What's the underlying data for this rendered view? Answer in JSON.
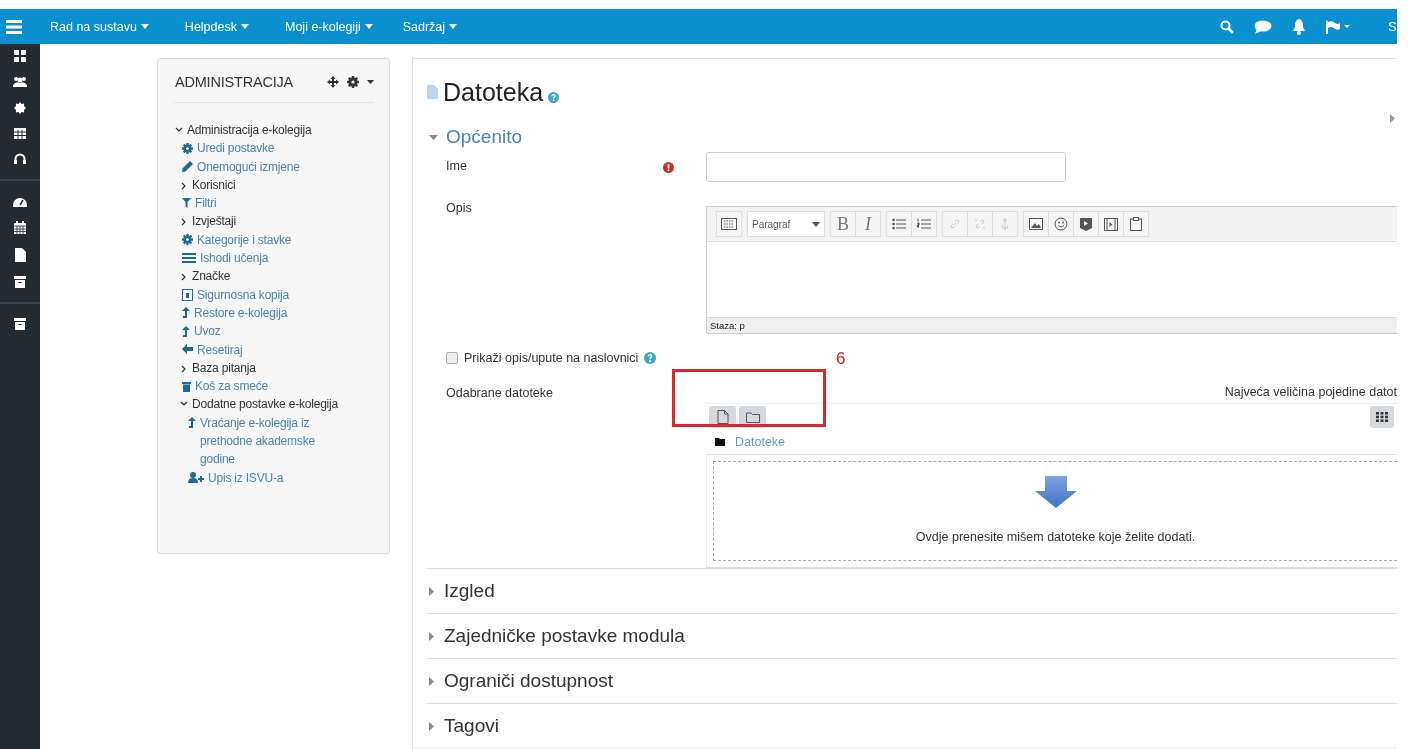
{
  "navbar": {
    "menus": [
      {
        "label": "Rad na sustavu"
      },
      {
        "label": "Helpdesk"
      },
      {
        "label": "Moji e-kolegiji"
      },
      {
        "label": "Sadržaj"
      }
    ],
    "user_initial": "S"
  },
  "block": {
    "title": "ADMINISTRACIJA",
    "tree": [
      {
        "label": "Administracija e-kolegija",
        "kind": "branch",
        "expanded": true,
        "children": [
          {
            "label": "Uredi postavke",
            "kind": "link"
          },
          {
            "label": "Onemogući izmjene",
            "kind": "link"
          },
          {
            "label": "Korisnici",
            "kind": "branch",
            "expanded": false
          },
          {
            "label": "Filtri",
            "kind": "link"
          },
          {
            "label": "Izvještaji",
            "kind": "branch",
            "expanded": false
          },
          {
            "label": "Kategorije i stavke",
            "kind": "link"
          },
          {
            "label": "Ishodi učenja",
            "kind": "link"
          },
          {
            "label": "Značke",
            "kind": "branch",
            "expanded": false
          },
          {
            "label": "Sigurnosna kopija",
            "kind": "link"
          },
          {
            "label": "Restore e-kolegija",
            "kind": "link"
          },
          {
            "label": "Uvoz",
            "kind": "link"
          },
          {
            "label": "Resetiraj",
            "kind": "link"
          },
          {
            "label": "Baza pitanja",
            "kind": "branch",
            "expanded": false
          },
          {
            "label": "Koš za smeće",
            "kind": "link"
          },
          {
            "label": "Dodatne postavke e-kolegija",
            "kind": "branch",
            "expanded": true,
            "children": [
              {
                "label": "Vraćanje e-kolegija iz prethodne akademske godine",
                "kind": "link"
              },
              {
                "label": "Upis iz ISVU-a",
                "kind": "link"
              }
            ]
          }
        ]
      }
    ]
  },
  "page": {
    "title": "Datoteka",
    "section": {
      "title": "Općenito",
      "expanded": true
    },
    "fields": [
      {
        "label": "Ime",
        "required": true
      },
      {
        "label": "Opis",
        "required": false
      }
    ],
    "editor": {
      "toolbar": [
        {
          "kind": "keyboard",
          "disabled": false
        },
        {
          "kind": "select",
          "label": "Paragraf",
          "disabled": false
        },
        {
          "kind": "text",
          "label": "B",
          "disabled": false
        },
        {
          "kind": "text",
          "label": "I",
          "disabled": false
        },
        {
          "kind": "bullets",
          "disabled": false
        },
        {
          "kind": "numbers",
          "disabled": false
        },
        {
          "kind": "link",
          "disabled": true
        },
        {
          "kind": "unlink",
          "disabled": true
        },
        {
          "kind": "anchor",
          "disabled": true
        },
        {
          "kind": "image",
          "disabled": false
        },
        {
          "kind": "smiley",
          "disabled": false
        },
        {
          "kind": "media",
          "disabled": false
        },
        {
          "kind": "film",
          "disabled": false
        },
        {
          "kind": "paste",
          "disabled": false
        }
      ],
      "path": "Staza: p"
    },
    "checkbox": {
      "label": "Prikaži opis/upute na naslovnici",
      "checked": false
    },
    "files": {
      "label": "Odabrane datoteke",
      "max_size": "Najveća veličina pojedine datot",
      "folder": "Datoteke",
      "drop_hint": "Ovdje prenesite mišem datoteke koje želite dodati."
    },
    "annotation": "6",
    "collapsed_sections": [
      {
        "title": "Izgled",
        "expanded": false
      },
      {
        "title": "Zajedničke postavke modula",
        "expanded": false
      },
      {
        "title": "Ograniči dostupnost",
        "expanded": false
      },
      {
        "title": "Tagovi",
        "expanded": false
      }
    ]
  }
}
